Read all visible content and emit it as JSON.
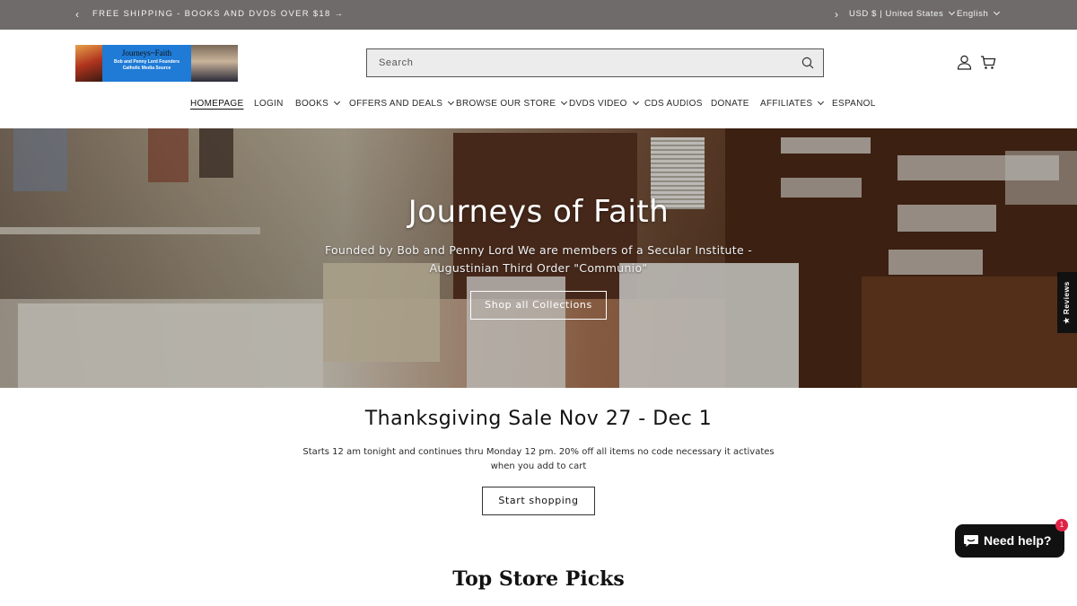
{
  "announcement": {
    "message": "FREE SHIPPING - BOOKS AND DVDS OVER $18 →",
    "prev_icon": "chevron-left-icon",
    "next_icon": "chevron-right-icon",
    "currency": "USD $ | United States",
    "language": "English"
  },
  "header": {
    "logo": {
      "title": "Journeys~Faith",
      "subtitle_line1": "Bob and Penny Lord Founders",
      "subtitle_line2": "Catholic Media Source"
    },
    "search": {
      "placeholder": "Search",
      "icon": "search-icon"
    },
    "account_icon": "user-icon",
    "cart_icon": "cart-icon"
  },
  "nav": [
    {
      "label": "HOMEPAGE",
      "dropdown": false,
      "active": true
    },
    {
      "label": "LOGIN",
      "dropdown": false
    },
    {
      "label": "BOOKS",
      "dropdown": true
    },
    {
      "label": "OFFERS AND DEALS",
      "dropdown": true
    },
    {
      "label": "BROWSE OUR STORE",
      "dropdown": true
    },
    {
      "label": "DVDS VIDEO",
      "dropdown": true
    },
    {
      "label": "CDS AUDIOS",
      "dropdown": false
    },
    {
      "label": "DONATE",
      "dropdown": false
    },
    {
      "label": "AFFILIATES",
      "dropdown": true
    },
    {
      "label": "ESPANOL",
      "dropdown": false
    }
  ],
  "hero": {
    "title": "Journeys of Faith",
    "subtitle": "Founded by Bob and Penny Lord We are members of a Secular Institute -Augustinian Third Order \"Communio\"",
    "cta": "Shop all Collections"
  },
  "reviews_tab": {
    "label": "★ Reviews"
  },
  "sale": {
    "title": "Thanksgiving Sale Nov 27 - Dec 1",
    "body": "Starts 12 am tonight and continues thru Monday 12 pm. 20% off all items no code necessary it activates when you add to cart",
    "cta": "Start shopping"
  },
  "top_picks": {
    "title": "Top Store Picks"
  },
  "chat": {
    "label": "Need help?",
    "badge": "1",
    "icon": "chat-bubble-icon"
  },
  "colors": {
    "announcement_bg": "#6f6b6b",
    "chat_bg": "#111111",
    "badge": "#e02445"
  }
}
